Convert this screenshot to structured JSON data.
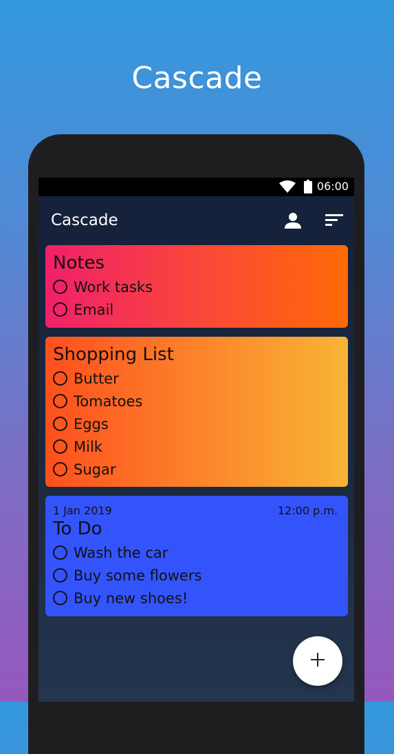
{
  "promo": {
    "title": "Cascade"
  },
  "status_bar": {
    "time": "06:00",
    "icons": [
      "wifi-icon",
      "battery-icon"
    ]
  },
  "appbar": {
    "title": "Cascade",
    "icons": [
      "account-icon",
      "sort-icon"
    ]
  },
  "cards": [
    {
      "title": "Notes",
      "items": [
        "Work tasks",
        "Email"
      ]
    },
    {
      "title": "Shopping List",
      "items": [
        "Butter",
        "Tomatoes",
        "Eggs",
        "Milk",
        "Sugar"
      ]
    },
    {
      "date": "1 Jan 2019",
      "time": "12:00 p.m.",
      "title": "To Do",
      "items": [
        "Wash the car",
        "Buy some flowers",
        "Buy new shoes!"
      ]
    }
  ],
  "fab": {
    "icon": "plus-icon"
  },
  "colors": {
    "notes_gradient": [
      "#f0206a",
      "#ff6a05"
    ],
    "shopping_gradient": [
      "#fe4f1e",
      "#f8b436"
    ],
    "todo": "#3454fb",
    "background": [
      "#3398dd",
      "#9658bd"
    ]
  }
}
